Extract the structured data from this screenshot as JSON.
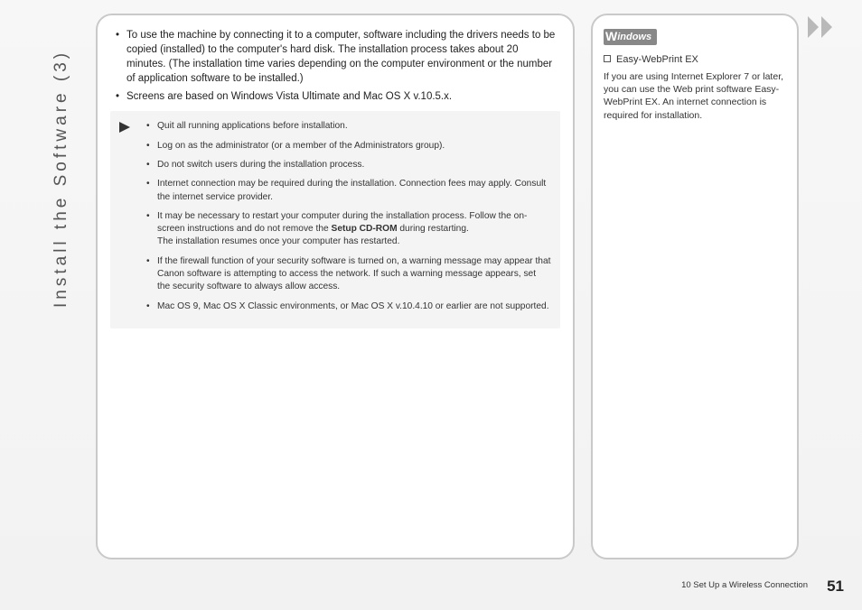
{
  "sidebar_title": "Install the Software (3)",
  "intro": {
    "bullets": [
      "To use the machine by connecting it to a computer, software including the drivers needs to be copied (installed) to the computer's hard disk. The installation process takes about 20 minutes. (The installation time varies depending on the computer environment or the number of application software to be installed.)",
      "Screens are based on Windows Vista Ultimate and Mac OS X v.10.5.x."
    ]
  },
  "notes": {
    "items": [
      {
        "text": "Quit all running applications before installation."
      },
      {
        "text": "Log on as the administrator (or a member of the Administrators group)."
      },
      {
        "text": "Do not switch users during the installation process."
      },
      {
        "text": "Internet connection may be required during the installation. Connection fees may apply. Consult the internet service provider."
      },
      {
        "pre": "It may be necessary to restart your computer during the installation process. Follow the on-screen instructions and do not remove the ",
        "bold": "Setup CD-ROM",
        "post": " during restarting.\nThe installation resumes once your computer has restarted."
      },
      {
        "text": "If the firewall function of your security software is turned on, a warning message may appear that Canon software is attempting to access the network. If such a warning message appears, set the security software to always allow access."
      },
      {
        "text": "Mac OS 9, Mac OS X Classic environments, or Mac OS X v.10.4.10 or earlier are not supported."
      }
    ]
  },
  "right": {
    "badge_w": "W",
    "badge_text": "indows",
    "item_label": "Easy-WebPrint EX",
    "desc": "If you are using Internet Explorer 7 or later, you can use the Web print software Easy-WebPrint EX. An internet connection is required for installation."
  },
  "footer": {
    "section": "10  Set Up a Wireless Connection",
    "page": "51"
  }
}
